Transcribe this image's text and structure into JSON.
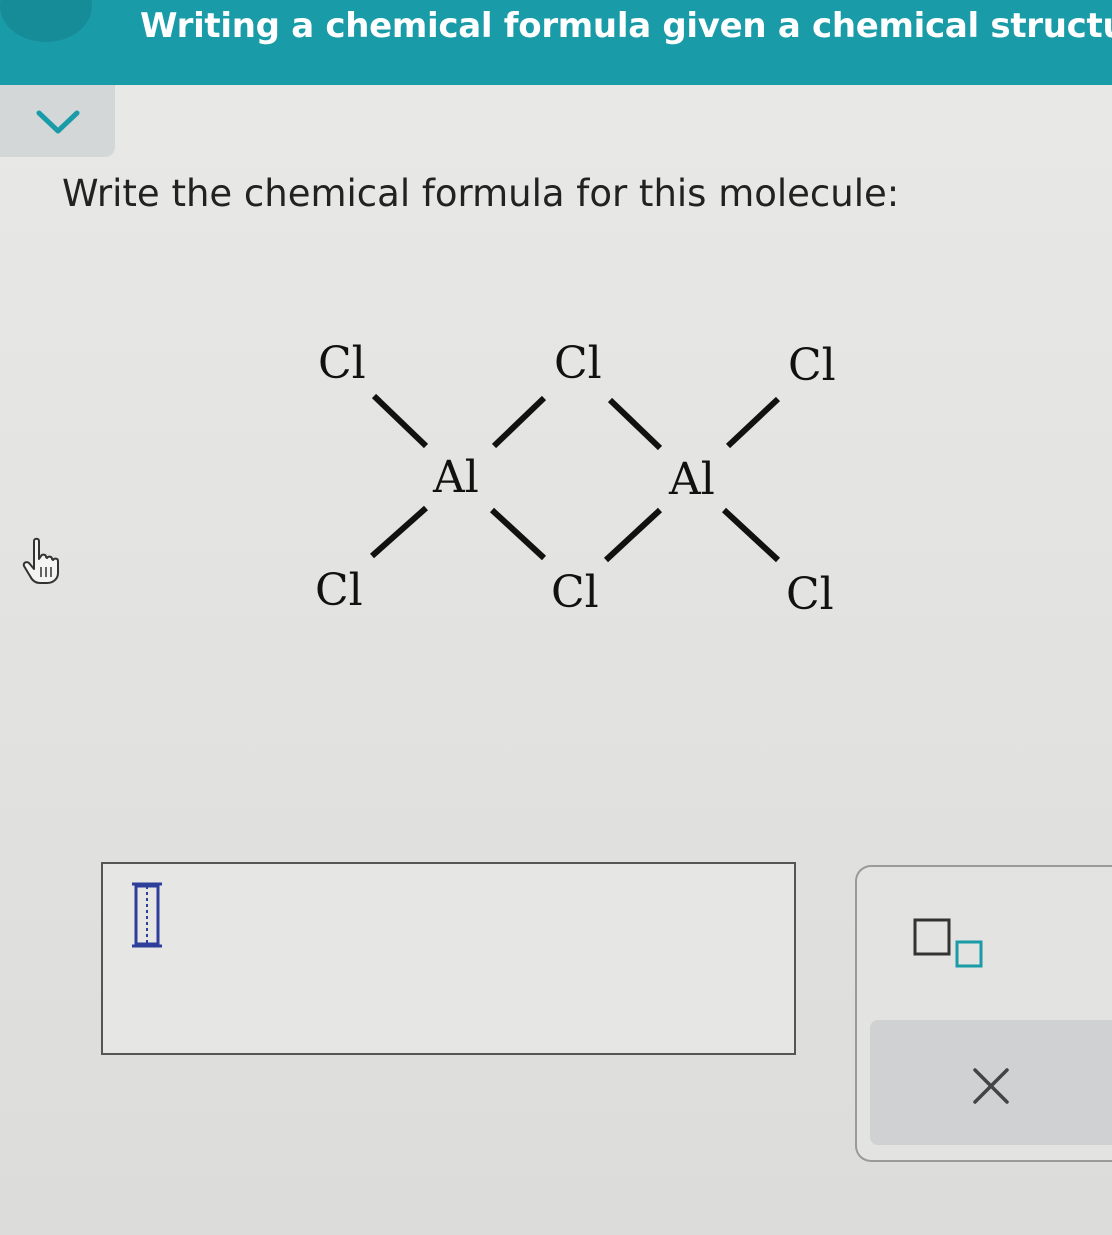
{
  "header": {
    "title": "Writing a chemical formula given a chemical structure",
    "background_color": "#1a9ba8",
    "menu_icon": "menu-icon"
  },
  "collapse_tab": {
    "icon": "chevron-down-icon",
    "color": "#1a9ba8"
  },
  "question": {
    "prompt": "Write the chemical formula for this molecule:"
  },
  "molecule": {
    "atoms": {
      "cl_top_left": "Cl",
      "cl_top_middle": "Cl",
      "cl_top_right": "Cl",
      "al_left": "Al",
      "al_right": "Al",
      "cl_bottom_left": "Cl",
      "cl_bottom_middle": "Cl",
      "cl_bottom_right": "Cl"
    }
  },
  "answer": {
    "value": "",
    "cursor_icon": "text-cursor-icon"
  },
  "tools": {
    "subscript_icon": "subscript-icon",
    "clear_icon": "close-icon",
    "accent_color": "#1a9ba8"
  },
  "pointer_icon": "hand-pointer-icon"
}
